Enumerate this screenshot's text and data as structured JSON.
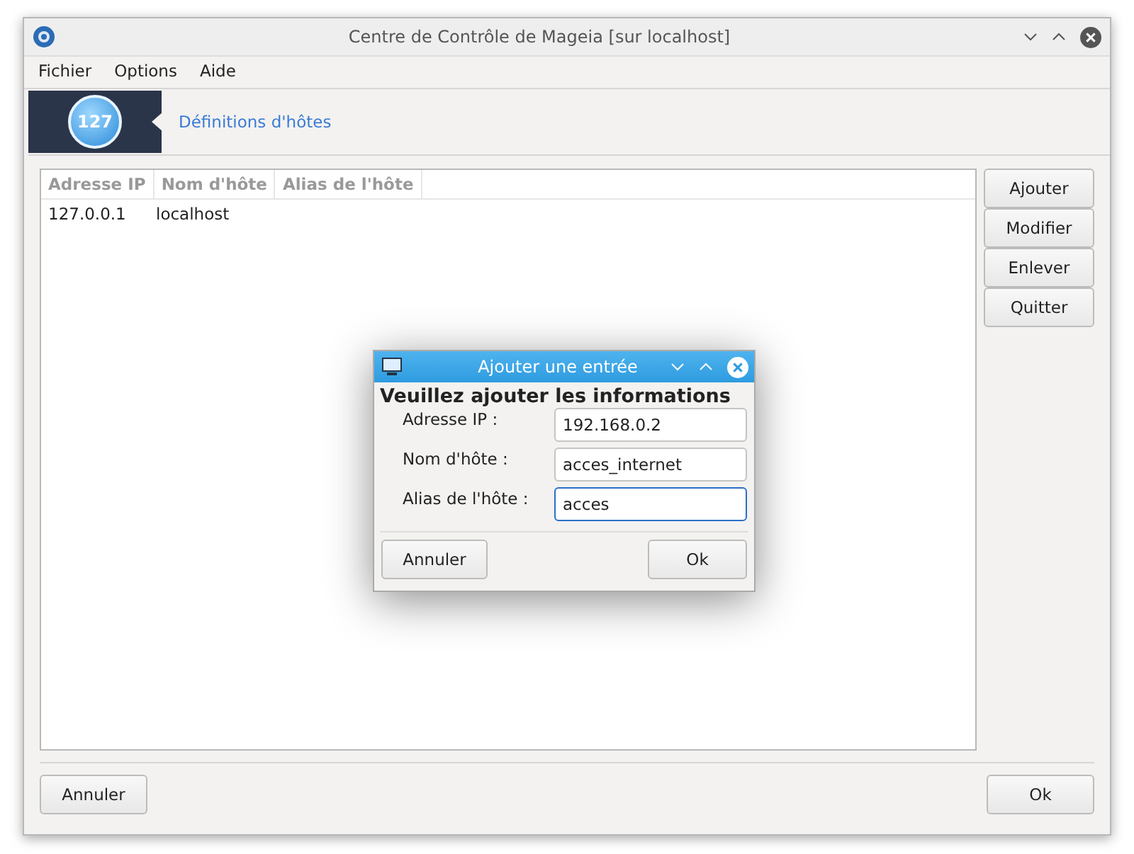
{
  "window": {
    "title": "Centre de Contrôle de Mageia [sur localhost]"
  },
  "menu": [
    "Fichier",
    "Options",
    "Aide"
  ],
  "banner": {
    "logo_text": "127",
    "title": "Définitions d'hôtes"
  },
  "table": {
    "columns": [
      "Adresse IP",
      "Nom d'hôte",
      "Alias de l'hôte"
    ],
    "rows": [
      [
        "127.0.0.1",
        "localhost",
        ""
      ]
    ]
  },
  "side_buttons": [
    "Ajouter",
    "Modifier",
    "Enlever",
    "Quitter"
  ],
  "footer": {
    "cancel": "Annuler",
    "ok": "Ok"
  },
  "dialog": {
    "title": "Ajouter une entrée",
    "heading": "Veuillez ajouter les informations",
    "fields": [
      {
        "label": "Adresse IP :",
        "value": "192.168.0.2",
        "focused": false
      },
      {
        "label": "Nom d'hôte :",
        "value": "acces_internet",
        "focused": false
      },
      {
        "label": "Alias de l'hôte :",
        "value": "acces",
        "focused": true
      }
    ],
    "cancel": "Annuler",
    "ok": "Ok"
  }
}
